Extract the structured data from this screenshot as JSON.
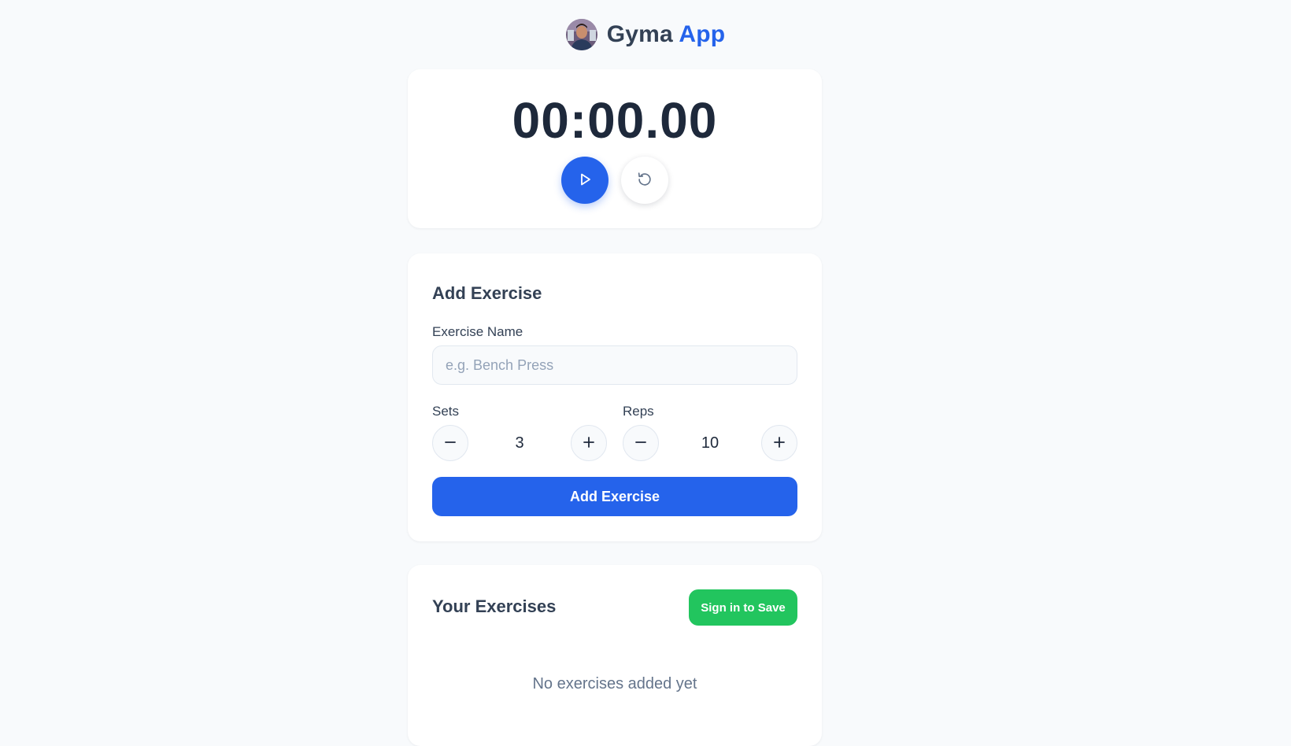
{
  "app": {
    "title_main": "Gyma",
    "title_accent": "App",
    "accent_color": "#2563eb"
  },
  "timer": {
    "display": "00:00.00",
    "play_icon": "play-icon",
    "reset_icon": "reset-icon"
  },
  "add_exercise": {
    "title": "Add Exercise",
    "name_label": "Exercise Name",
    "name_value": "",
    "name_placeholder": "e.g. Bench Press",
    "sets_label": "Sets",
    "sets_value": "3",
    "reps_label": "Reps",
    "reps_value": "10",
    "submit_label": "Add Exercise",
    "minus_icon": "minus-icon",
    "plus_icon": "plus-icon"
  },
  "exercises": {
    "title": "Your Exercises",
    "save_label": "Sign in to Save",
    "save_color": "#22c55e",
    "empty_text": "No exercises added yet"
  }
}
